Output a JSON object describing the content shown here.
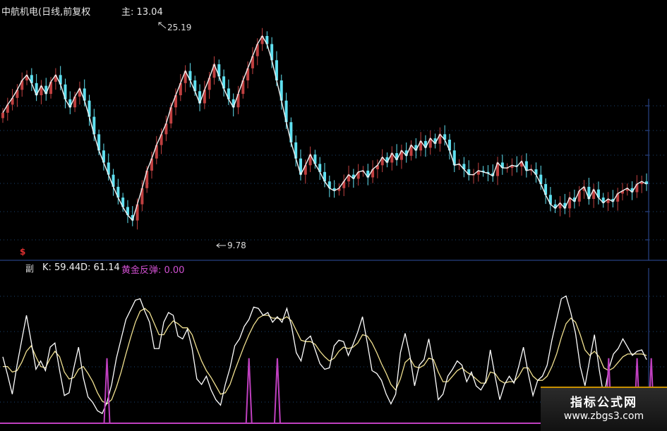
{
  "header": {
    "title": "中航机电(日线,前复权",
    "price_note": "主: 13.04"
  },
  "indicator": {
    "name": "副",
    "k_label": "K: 59.44",
    "d_label": "D: 61.14",
    "gold_label": "黄金反弹: 0.00"
  },
  "markers": {
    "high": "25.19",
    "low": "9.78",
    "signal": "$"
  },
  "watermark": {
    "line1": "指标公式网",
    "line2": "www.zbgs3.com"
  },
  "colors": {
    "up": "#c04040",
    "down": "#60e0f0",
    "k_line": "#ffffff",
    "d_line": "#f0e090",
    "gold": "#c040c0",
    "grid": "#1c4470",
    "axis": "#3050a0"
  },
  "chart_data": [
    {
      "type": "candlestick",
      "title": "中航机电(日线,前复权",
      "annotations": [
        "25.19",
        "9.78"
      ],
      "ylim": [
        9.5,
        26
      ],
      "closes": [
        19.2,
        19.8,
        20.3,
        20.9,
        21.6,
        22.0,
        21.4,
        20.5,
        21.2,
        20.6,
        21.5,
        22.0,
        21.3,
        20.2,
        19.6,
        20.4,
        21.0,
        20.1,
        18.9,
        17.6,
        16.4,
        15.5,
        14.6,
        13.7,
        12.9,
        12.2,
        11.6,
        11.2,
        12.4,
        13.6,
        14.9,
        15.8,
        16.8,
        17.6,
        18.4,
        19.6,
        20.5,
        21.4,
        22.3,
        21.6,
        20.8,
        19.9,
        20.9,
        21.8,
        22.8,
        21.9,
        21.0,
        20.2,
        19.6,
        20.6,
        21.6,
        22.5,
        23.4,
        24.3,
        24.9,
        24.3,
        23.1,
        21.6,
        20.1,
        18.5,
        17.0,
        15.8,
        14.6,
        15.3,
        16.1,
        15.4,
        14.8,
        14.1,
        13.6,
        13.4,
        13.6,
        14.1,
        14.6,
        14.3,
        14.8,
        14.9,
        14.4,
        15.0,
        15.3,
        15.9,
        15.5,
        16.2,
        15.7,
        16.4,
        16.0,
        16.8,
        16.4,
        17.1,
        16.6,
        17.3,
        16.9,
        17.6,
        17.2,
        16.4,
        15.3,
        15.4,
        15.0,
        14.6,
        14.6,
        14.9,
        14.8,
        14.7,
        14.5,
        15.5,
        15.1,
        15.1,
        15.3,
        15.2,
        15.6,
        14.9,
        15.0,
        14.6,
        13.9,
        13.1,
        12.4,
        12.1,
        12.5,
        12.1,
        12.9,
        12.6,
        13.4,
        13.7,
        12.8,
        13.5,
        12.9,
        12.5,
        12.8,
        12.6,
        13.2,
        13.4,
        13.6,
        13.3,
        13.9,
        14.1,
        13.9
      ]
    },
    {
      "type": "line",
      "series": [
        {
          "name": "K",
          "last": 59.44
        },
        {
          "name": "D",
          "last": 61.14
        },
        {
          "name": "黄金反弹",
          "last": 0.0
        }
      ],
      "ylim": [
        0,
        100
      ],
      "k": [
        46,
        33,
        19,
        40,
        58,
        76,
        57,
        37,
        43,
        36,
        53,
        56,
        36,
        18,
        20,
        38,
        53,
        31,
        17,
        13,
        7,
        5,
        13,
        26,
        45,
        59,
        73,
        80,
        87,
        88,
        79,
        71,
        52,
        52,
        71,
        78,
        76,
        61,
        59,
        66,
        52,
        30,
        26,
        32,
        22,
        15,
        11,
        26,
        38,
        54,
        59,
        68,
        73,
        82,
        81,
        76,
        78,
        71,
        75,
        71,
        81,
        68,
        49,
        43,
        58,
        61,
        51,
        41,
        37,
        38,
        54,
        58,
        57,
        47,
        55,
        64,
        75,
        56,
        36,
        34,
        29,
        19,
        12,
        19,
        49,
        63,
        47,
        25,
        40,
        44,
        59,
        40,
        15,
        19,
        32,
        37,
        43,
        40,
        28,
        35,
        25,
        22,
        28,
        51,
        32,
        15,
        26,
        32,
        27,
        39,
        53,
        34,
        18,
        29,
        32,
        40,
        58,
        73,
        88,
        90,
        78,
        63,
        39,
        25,
        44,
        62,
        37,
        17,
        37,
        48,
        52,
        59,
        53,
        47,
        50,
        51,
        44
      ],
      "d": [
        39,
        39,
        35,
        36,
        42,
        50,
        54,
        46,
        39,
        38,
        45,
        50,
        46,
        35,
        30,
        31,
        37,
        39,
        34,
        28,
        20,
        14,
        12,
        15,
        24,
        35,
        48,
        60,
        71,
        79,
        81,
        78,
        70,
        62,
        62,
        68,
        72,
        70,
        67,
        67,
        62,
        52,
        43,
        36,
        31,
        25,
        19,
        20,
        26,
        36,
        45,
        54,
        62,
        69,
        74,
        76,
        76,
        74,
        74,
        73,
        75,
        72,
        65,
        58,
        57,
        57,
        55,
        50,
        46,
        43,
        45,
        50,
        53,
        52,
        53,
        56,
        62,
        61,
        56,
        49,
        41,
        34,
        26,
        22,
        30,
        42,
        45,
        39,
        38,
        40,
        45,
        44,
        35,
        28,
        28,
        32,
        36,
        38,
        35,
        33,
        30,
        27,
        27,
        35,
        34,
        29,
        27,
        28,
        28,
        32,
        38,
        38,
        32,
        29,
        29,
        32,
        39,
        48,
        60,
        70,
        74,
        71,
        62,
        51,
        47,
        50,
        46,
        38,
        36,
        38,
        42,
        46,
        48,
        48,
        48,
        48,
        47
      ],
      "gold_spikes": [
        22,
        52,
        58,
        128,
        134,
        137
      ]
    }
  ]
}
